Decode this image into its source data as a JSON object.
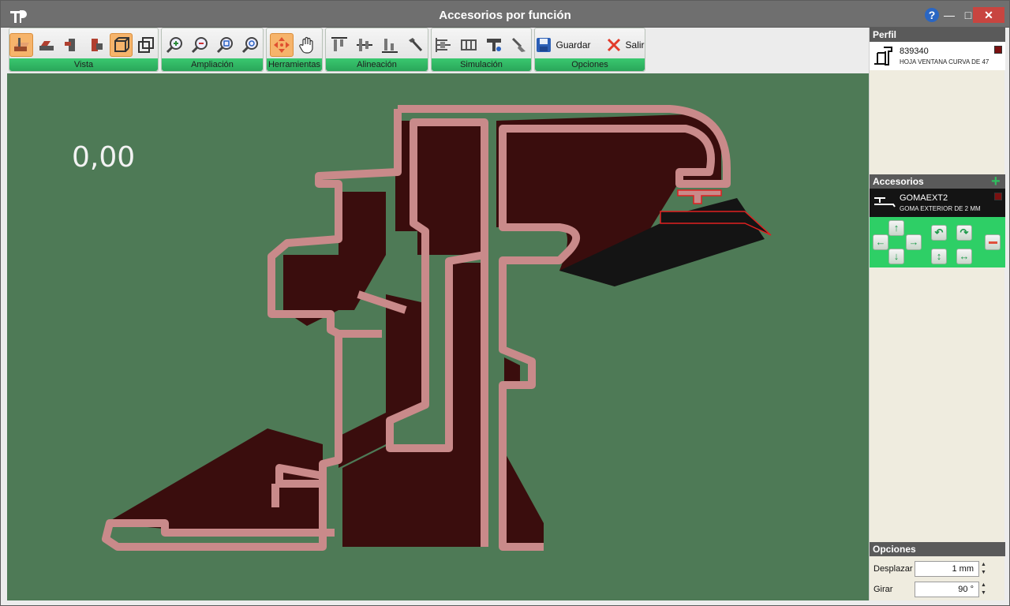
{
  "window": {
    "title": "Accesorios por función"
  },
  "toolbar": {
    "groups": [
      {
        "label": "Vista"
      },
      {
        "label": "Ampliación"
      },
      {
        "label": "Herramientas"
      },
      {
        "label": "Alineación"
      },
      {
        "label": "Simulación"
      },
      {
        "label": "Opciones"
      }
    ],
    "save_label": "Guardar",
    "exit_label": "Salir"
  },
  "canvas": {
    "measure_value": "0,00",
    "profile_color": "#c98a8a",
    "shadow_color": "#3a0d0d",
    "background": "#4e7a56"
  },
  "sidebar": {
    "profile_header": "Perfil",
    "profile": {
      "code": "839340",
      "description": "HOJA VENTANA CURVA DE 47",
      "color": "#7a1010"
    },
    "accessories_header": "Accesorios",
    "accessory": {
      "code": "GOMAEXT2",
      "description": "GOMA EXTERIOR DE 2 MM",
      "color": "#7a1010"
    },
    "options_header": "Opciones",
    "options": {
      "shift_label": "Desplazar",
      "shift_value": "1 mm",
      "rotate_label": "Girar",
      "rotate_value": "90 °"
    }
  },
  "icons": [
    "app-icon",
    "help-icon",
    "minimize-icon",
    "maximize-icon",
    "close-icon",
    "save-icon",
    "exit-icon",
    "add-icon",
    "remove-icon"
  ]
}
